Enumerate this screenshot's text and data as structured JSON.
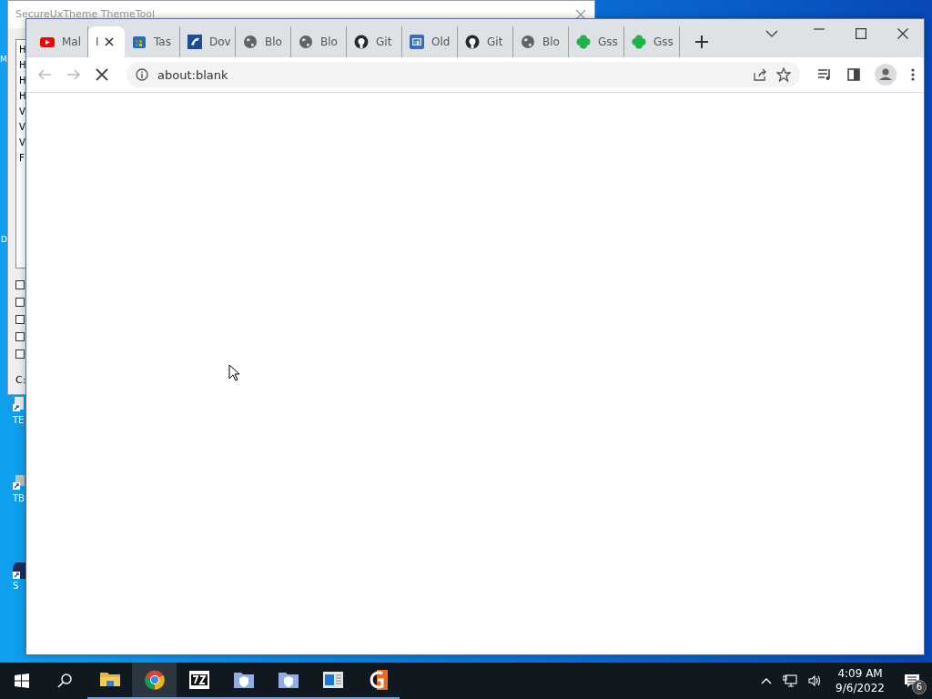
{
  "background_window": {
    "title": "SecureUxTheme ThemeTool",
    "list_items": [
      "H",
      "H",
      "H",
      "H",
      "V",
      "V",
      "V",
      "F"
    ],
    "checkboxes": [
      {
        "checked": false
      },
      {
        "checked": false
      },
      {
        "checked": false
      },
      {
        "checked": false
      },
      {
        "checked": false
      }
    ],
    "status_text": "C:"
  },
  "desktop": {
    "labels": [
      "M",
      "D"
    ],
    "icons": [
      {
        "label": "TE",
        "kind": "doc"
      },
      {
        "label": "TB",
        "kind": "box"
      },
      {
        "label": "S",
        "kind": "disc"
      }
    ]
  },
  "browser": {
    "tabs": [
      {
        "title": "Mal",
        "kind": "youtube",
        "selected": false
      },
      {
        "title": "I",
        "kind": "plain",
        "selected": true
      },
      {
        "title": "Tas",
        "kind": "store",
        "selected": false
      },
      {
        "title": "Dov",
        "kind": "bluesquare",
        "selected": false
      },
      {
        "title": "Blo",
        "kind": "globe",
        "selected": false
      },
      {
        "title": "Blo",
        "kind": "globe",
        "selected": false
      },
      {
        "title": "Git",
        "kind": "github",
        "selected": false
      },
      {
        "title": "Old",
        "kind": "mbox",
        "selected": false
      },
      {
        "title": "Git",
        "kind": "github",
        "selected": false
      },
      {
        "title": "Blo",
        "kind": "globe",
        "selected": false
      },
      {
        "title": "Gss",
        "kind": "clover",
        "selected": false
      },
      {
        "title": "Gss",
        "kind": "clover",
        "selected": false
      }
    ],
    "address": "about:blank",
    "loading": true
  },
  "taskbar": {
    "apps": [
      {
        "kind": "folder",
        "active": false
      },
      {
        "kind": "chrome",
        "active": true
      },
      {
        "kind": "sevenzip",
        "active": false
      },
      {
        "kind": "shieldfolder",
        "active": false
      },
      {
        "kind": "shieldfolder",
        "active": false
      },
      {
        "kind": "appwindow",
        "active": false
      },
      {
        "kind": "glogo",
        "active": false
      }
    ],
    "time": "4:09 AM",
    "date": "9/6/2022",
    "notification_count": "6"
  }
}
